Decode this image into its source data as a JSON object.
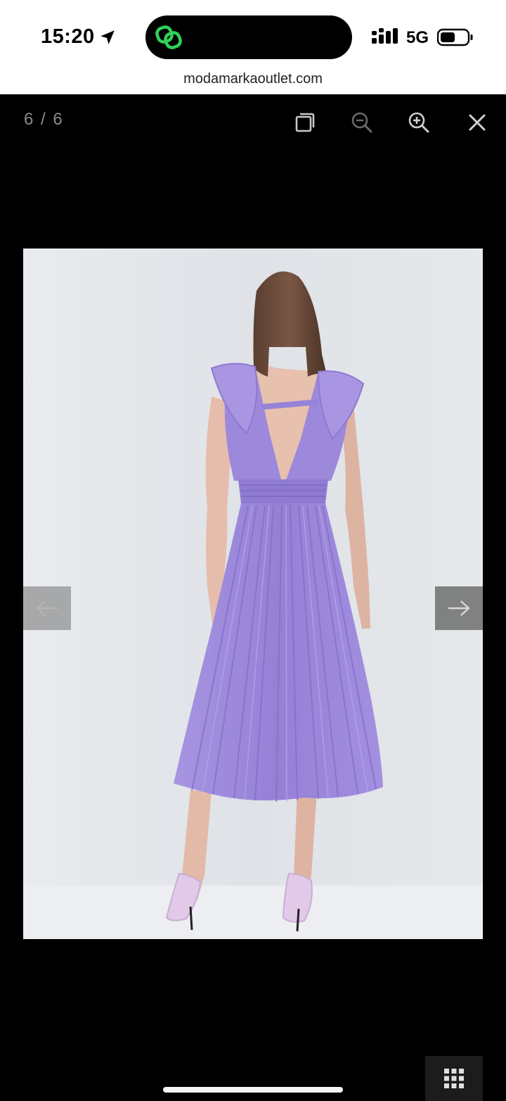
{
  "status_bar": {
    "time": "15:20",
    "network": "5G",
    "location_icon": "location-arrow-icon",
    "signal_icon": "cellular-signal-icon",
    "battery_icon": "battery-icon",
    "island_app_icon": "link-icon",
    "island_icon_color": "#30d158"
  },
  "browser": {
    "url": "modamarkaoutlet.com"
  },
  "gallery": {
    "counter": "6 / 6",
    "toolbar": {
      "fullscreen_icon": "fullscreen-icon",
      "zoom_out_icon": "zoom-out-icon",
      "zoom_in_icon": "zoom-in-icon",
      "close_icon": "close-icon"
    },
    "prev_icon": "arrow-left-icon",
    "next_icon": "arrow-right-icon",
    "thumbnails_icon": "grid-icon",
    "photo": {
      "subject": "product-photo",
      "dress_color": "#9a86d9",
      "background_color": "#e4e6ea"
    }
  }
}
